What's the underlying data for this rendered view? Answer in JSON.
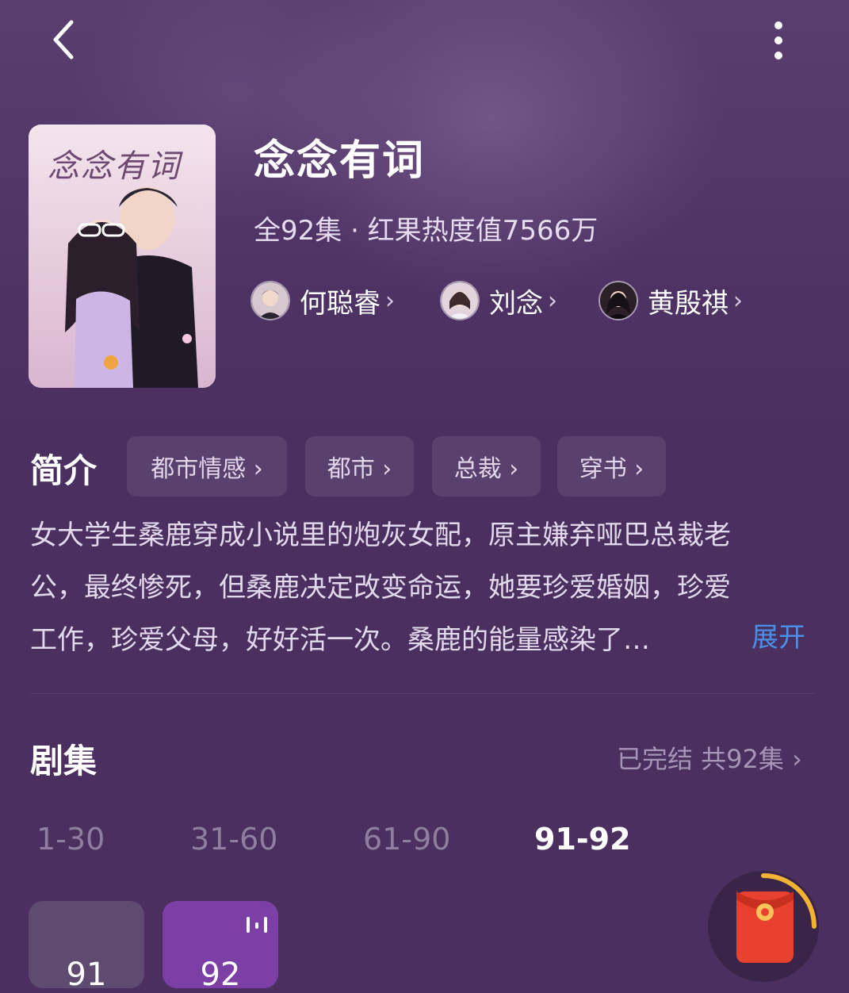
{
  "header": {
    "back_icon": "chevron-left-icon",
    "more_icon": "more-vertical-icon"
  },
  "drama": {
    "title": "念念有词",
    "poster_title": "念念有词",
    "meta": "全92集 · 红果热度值7566万",
    "cast": [
      {
        "name": "何聪睿",
        "chev": "›"
      },
      {
        "name": "刘念",
        "chev": "›"
      },
      {
        "name": "黄殷祺",
        "chev": "›"
      }
    ]
  },
  "intro": {
    "heading": "简介",
    "tags": [
      "都市情感 ›",
      "都市 ›",
      "总裁 ›",
      "穿书 ›"
    ],
    "lines": [
      "女大学生桑鹿穿成小说里的炮灰女配，原主嫌弃哑巴总裁老",
      "公，最终惨死，但桑鹿决定改变命运，她要珍爱婚姻，珍爱",
      "工作，珍爱父母，好好活一次。桑鹿的能量感染了…"
    ],
    "expand": "展开"
  },
  "episodes": {
    "heading": "剧集",
    "status": "已完结 共92集 ›",
    "ranges": [
      "1-30",
      "31-60",
      "61-90",
      "91-92"
    ],
    "active_range": "91-92",
    "cards": [
      "91",
      "92"
    ],
    "playing_card": "92",
    "playing_icon": "audio-bars-icon"
  },
  "fab": {
    "icon": "red-envelope-icon"
  },
  "colors": {
    "background": "#4a2f5f",
    "accent_link": "#4a8fe8",
    "episode_card": "#5f4a70",
    "episode_card_active": "#7b3fa6",
    "fab_ring": "#f2b233",
    "red_envelope": "#e8412f"
  }
}
